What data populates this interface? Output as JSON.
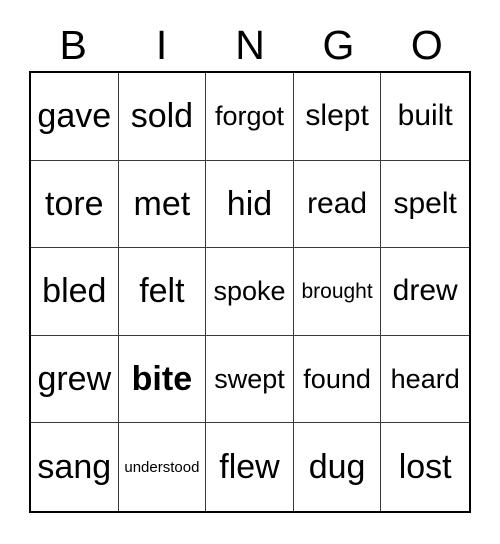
{
  "card": {
    "header": {
      "letters": [
        "B",
        "I",
        "N",
        "G",
        "O"
      ]
    },
    "grid": {
      "rows": 5,
      "columns": 5,
      "cells": [
        {
          "text": "gave",
          "size": "size-xl",
          "free": false
        },
        {
          "text": "sold",
          "size": "size-xl",
          "free": false
        },
        {
          "text": "forgot",
          "size": "size-md",
          "free": false
        },
        {
          "text": "slept",
          "size": "size-lg",
          "free": false
        },
        {
          "text": "built",
          "size": "size-lg",
          "free": false
        },
        {
          "text": "tore",
          "size": "size-xl",
          "free": false
        },
        {
          "text": "met",
          "size": "size-xl",
          "free": false
        },
        {
          "text": "hid",
          "size": "size-xl",
          "free": false
        },
        {
          "text": "read",
          "size": "size-lg",
          "free": false
        },
        {
          "text": "spelt",
          "size": "size-lg",
          "free": false
        },
        {
          "text": "bled",
          "size": "size-xl",
          "free": false
        },
        {
          "text": "felt",
          "size": "size-xl",
          "free": false
        },
        {
          "text": "spoke",
          "size": "size-md",
          "free": false
        },
        {
          "text": "brought",
          "size": "size-sm",
          "free": false
        },
        {
          "text": "drew",
          "size": "size-lg",
          "free": false
        },
        {
          "text": "grew",
          "size": "size-xl",
          "free": false
        },
        {
          "text": "bite",
          "size": "size-xl",
          "free": true
        },
        {
          "text": "swept",
          "size": "size-md",
          "free": false
        },
        {
          "text": "found",
          "size": "size-md",
          "free": false
        },
        {
          "text": "heard",
          "size": "size-md",
          "free": false
        },
        {
          "text": "sang",
          "size": "size-xl",
          "free": false
        },
        {
          "text": "understood",
          "size": "size-xs",
          "free": false
        },
        {
          "text": "flew",
          "size": "size-xl",
          "free": false
        },
        {
          "text": "dug",
          "size": "size-xl",
          "free": false
        },
        {
          "text": "lost",
          "size": "size-xl",
          "free": false
        }
      ]
    },
    "colors": {
      "text": "#000000",
      "background": "#ffffff",
      "outer_border": "#000000",
      "grid_line": "#3a3a3a"
    }
  }
}
